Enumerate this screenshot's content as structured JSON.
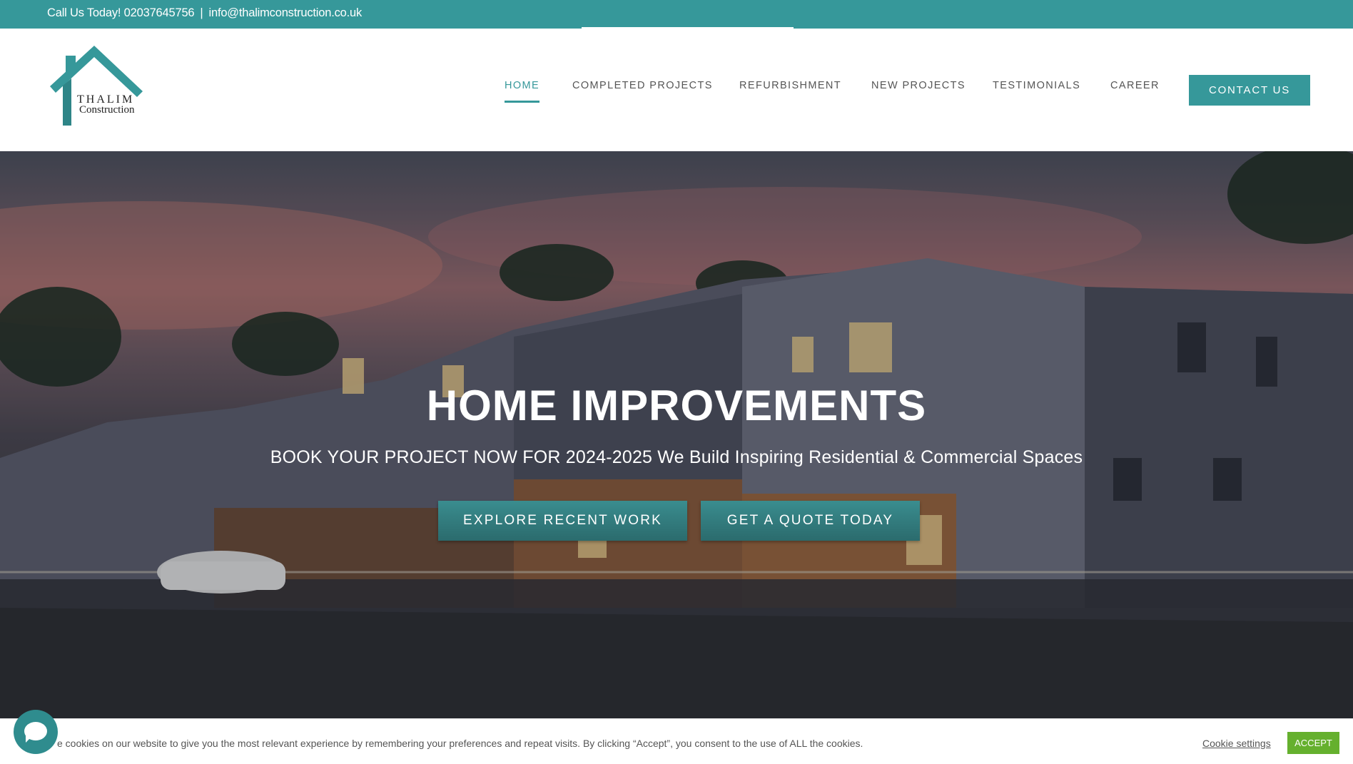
{
  "topbar": {
    "call_text": "Call Us Today! 02037645756",
    "separator": "|",
    "email": "info@thalimconstruction.co.uk"
  },
  "logo": {
    "line1": "THALIM",
    "line2": "Construction"
  },
  "nav": {
    "items": [
      {
        "label": "HOME",
        "active": true
      },
      {
        "label": "COMPLETED PROJECTS"
      },
      {
        "label": "REFURBISHMENT"
      },
      {
        "label": "NEW PROJECTS"
      },
      {
        "label": "TESTIMONIALS"
      },
      {
        "label": "CAREER"
      }
    ],
    "contact_label": "CONTACT US"
  },
  "hero": {
    "title": "HOME IMPROVEMENTS",
    "subtitle": "BOOK YOUR PROJECT NOW FOR 2024-2025 We Build Inspiring Residential & Commercial Spaces",
    "btn_explore": "EXPLORE RECENT WORK",
    "btn_quote": "GET A QUOTE TODAY"
  },
  "cookie": {
    "text": "e cookies on our website to give you the most relevant experience by remembering your preferences and repeat visits. By clicking “Accept”, you consent to the use of ALL the cookies.",
    "settings_label": "Cookie settings",
    "accept_label": "ACCEPT"
  },
  "colors": {
    "brand": "#36989a",
    "accept": "#65b02e"
  }
}
